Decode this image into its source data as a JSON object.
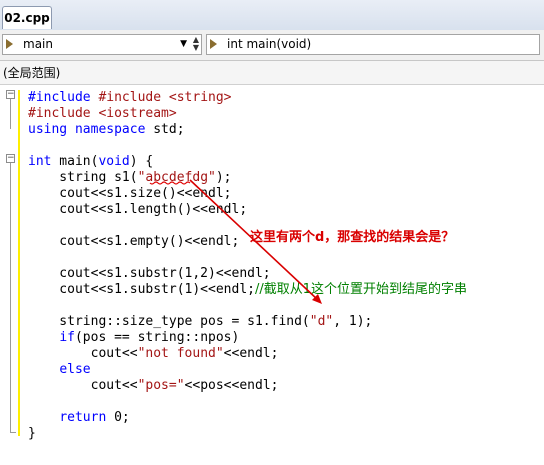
{
  "tab": {
    "label": "02.cpp"
  },
  "nav": {
    "scope_combo": "main",
    "member_combo": "int main(void)"
  },
  "scope_label": "(全局范围)",
  "code": {
    "l1": "#include <string>",
    "l2": "#include <iostream>",
    "l3_kw": "using namespace",
    "l3_rest": " std;",
    "l5_kw": "int",
    "l5_a": " main(",
    "l5_kw2": "void",
    "l5_b": ") {",
    "l6_a": "    string s1(",
    "l6_str": "\"abcdefdg\"",
    "l6_b": ");",
    "l7": "    cout<<s1.size()<<endl;",
    "l8": "    cout<<s1.length()<<endl;",
    "l10": "    cout<<s1.empty()<<endl;",
    "l12": "    cout<<s1.substr(1,2)<<endl;",
    "l13_a": "    cout<<s1.substr(1)<<endl;",
    "l13_cm": "//截取从1这个位置开始到结尾的字串",
    "l15_a": "    string::size_type pos = s1.find(",
    "l15_str": "\"d\"",
    "l15_b": ", 1);",
    "l16_kw": "if",
    "l16_rest": "(pos == string::npos)",
    "l17_a": "        cout<<",
    "l17_str": "\"not found\"",
    "l17_b": "<<endl;",
    "l18_kw": "else",
    "l19_a": "        cout<<",
    "l19_str": "\"pos=\"",
    "l19_b": "<<pos<<endl;",
    "l21_kw": "return",
    "l21_rest": " 0;",
    "l22": "}"
  },
  "annotation": "这里有两个d，那查找的结果会是？",
  "colors": {
    "keyword": "#0000ff",
    "string": "#a31515",
    "comment": "#008000",
    "annotation": "#d90000"
  }
}
